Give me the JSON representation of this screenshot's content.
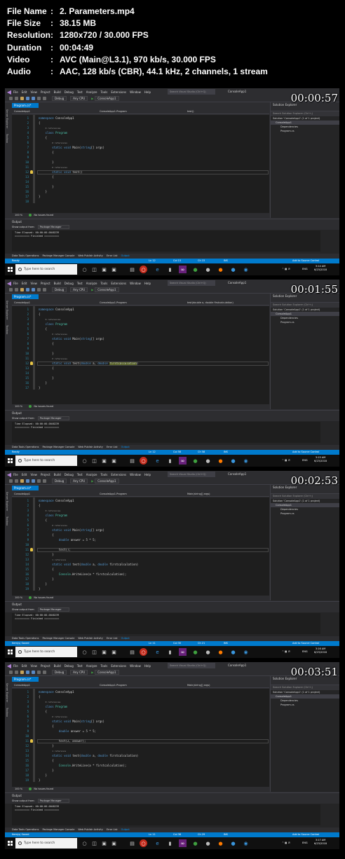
{
  "info": [
    {
      "label": "File Name",
      "value": "2. Parameters.mp4"
    },
    {
      "label": "File Size",
      "value": "38.15 MB"
    },
    {
      "label": "Resolution",
      "value": "1280x720 / 30.000 FPS"
    },
    {
      "label": "Duration",
      "value": "00:04:49"
    },
    {
      "label": "Video",
      "value": "AVC (Main@L3.1), 970 kb/s, 30.000 FPS"
    },
    {
      "label": "Audio",
      "value": "AAC, 128 kb/s (CBR), 44.1 kHz, 2 channels, 1 stream"
    }
  ],
  "colon": ":",
  "ide": {
    "menu": [
      "File",
      "Edit",
      "View",
      "Project",
      "Build",
      "Debug",
      "Test",
      "Analyze",
      "Tools",
      "Extensions",
      "Window",
      "Help"
    ],
    "quick_search": "Search Visual Studio (Ctrl+Q)",
    "project_name": "ConsoleApp1",
    "config": "Debug",
    "platform": "Any CPU",
    "run_target": "ConsoleApp1",
    "side_tab_1": "Server Explorer",
    "side_tab_2": "Toolbox",
    "doc_tab": "Program.cs*",
    "nav_project": "ConsoleApp1",
    "nav_class": "ConsoleApp1.Program",
    "no_issues": "No issues found",
    "zoom": "100 %",
    "solution_explorer": {
      "title": "Solution Explorer",
      "search": "Search Solution Explorer (Ctrl+;)",
      "solution": "Solution 'ConsoleApp1' (1 of 1 project)",
      "project": "ConsoleApp1",
      "dependencies": "Dependencies",
      "file": "Program.cs"
    },
    "output": {
      "title": "Output",
      "show_from_label": "Show output from:",
      "show_from_value": "Package Manager",
      "line1": "Time Elapsed: 00:00:00.0048239",
      "line2": "========== Finished =========="
    },
    "bottom_tabs": [
      "Data Tools Operations",
      "Package Manager Console",
      "Web Publish Activity",
      "Error List",
      "Output"
    ],
    "add_source": "Add to Source Control",
    "ins": "INS"
  },
  "taskbar": {
    "search_placeholder": "Type here to search",
    "lang": "ENG"
  },
  "frames": [
    {
      "timestamp": "00:00:57",
      "nav_member": "test()",
      "status_left": "Ready",
      "ln": "Ln 12",
      "col": "Col 15",
      "ch": "Ch 15",
      "time": "3:14 AM",
      "date": "6/23/2018",
      "lines": [
        {
          "n": "1",
          "html": "<span class='kw'>namespace</span> ConsoleApp1"
        },
        {
          "n": "2",
          "html": "{"
        },
        {
          "n": "3",
          "html": "    <span class='ref'>0 references</span>"
        },
        {
          "n": "4",
          "html": "    <span class='kw'>class</span> <span class='ty'>Program</span>"
        },
        {
          "n": "5",
          "html": "    {"
        },
        {
          "n": "6",
          "html": "        <span class='ref'>0 references</span>"
        },
        {
          "n": "7",
          "html": "        <span class='kw'>static</span> <span class='kw'>void</span> Main(<span class='kw'>string</span>[] args)"
        },
        {
          "n": "8",
          "html": "        {"
        },
        {
          "n": "9",
          "html": ""
        },
        {
          "n": "10",
          "html": "        }"
        },
        {
          "n": "11",
          "html": "        <span class='ref'>0 references</span>"
        },
        {
          "n": "12",
          "html": "        <span class='kw'>static</span> <span class='kw'>void</span> test()"
        },
        {
          "n": "13",
          "html": "        {"
        },
        {
          "n": "14",
          "html": ""
        },
        {
          "n": "15",
          "html": "        }"
        },
        {
          "n": "16",
          "html": "    }"
        },
        {
          "n": "17",
          "html": "}"
        },
        {
          "n": "18",
          "html": ""
        }
      ],
      "cursor_line": 12
    },
    {
      "timestamp": "00:01:55",
      "nav_member": "test(double a, double firstcalculation)",
      "status_left": "Ready",
      "ln": "Ln 12",
      "col": "Col 58",
      "ch": "Ch 58",
      "time": "3:15 AM",
      "date": "6/23/2018",
      "lines": [
        {
          "n": "1",
          "html": "<span class='kw'>namespace</span> ConsoleApp1"
        },
        {
          "n": "2",
          "html": "{"
        },
        {
          "n": "3",
          "html": "    <span class='ref'>0 references</span>"
        },
        {
          "n": "4",
          "html": "    <span class='kw'>class</span> <span class='ty'>Program</span>"
        },
        {
          "n": "5",
          "html": "    {"
        },
        {
          "n": "6",
          "html": "        <span class='ref'>0 references</span>"
        },
        {
          "n": "7",
          "html": "        <span class='kw'>static</span> <span class='kw'>void</span> Main(<span class='kw'>string</span>[] args)"
        },
        {
          "n": "8",
          "html": "        {"
        },
        {
          "n": "9",
          "html": ""
        },
        {
          "n": "10",
          "html": "        }"
        },
        {
          "n": "11",
          "html": "        <span class='ref'>0 references</span>"
        },
        {
          "n": "12",
          "html": "        <span class='kw'>static</span> <span class='kw'>void</span> test(<span class='kw'>double</span> a, <span class='kw'>double</span> <span class='hl'>firstcalculation</span>)"
        },
        {
          "n": "13",
          "html": "        {"
        },
        {
          "n": "14",
          "html": ""
        },
        {
          "n": "15",
          "html": "        }"
        },
        {
          "n": "16",
          "html": "    }"
        },
        {
          "n": "17",
          "html": "}"
        }
      ],
      "cursor_line": 12
    },
    {
      "timestamp": "00:02:53",
      "nav_member": "Main(string[] args)",
      "status_left": "Item(s) Saved",
      "ln": "Ln 11",
      "col": "Col 30",
      "ch": "Ch 21",
      "time": "3:16 AM",
      "date": "6/23/2018",
      "lines": [
        {
          "n": "1",
          "html": "<span class='kw'>namespace</span> ConsoleApp1"
        },
        {
          "n": "2",
          "html": "{"
        },
        {
          "n": "3",
          "html": "    <span class='ref'>0 references</span>"
        },
        {
          "n": "4",
          "html": "    <span class='kw'>class</span> <span class='ty'>Program</span>"
        },
        {
          "n": "5",
          "html": "    {"
        },
        {
          "n": "6",
          "html": "        <span class='ref'>0 references</span>"
        },
        {
          "n": "7",
          "html": "        <span class='kw'>static</span> <span class='kw'>void</span> Main(<span class='kw'>string</span>[] args)"
        },
        {
          "n": "8",
          "html": "        {"
        },
        {
          "n": "9",
          "html": "            <span class='kw'>double</span> answer = 5 * 5;"
        },
        {
          "n": "10",
          "html": ""
        },
        {
          "n": "11",
          "html": "            test();"
        },
        {
          "n": "12",
          "html": "        }"
        },
        {
          "n": "13",
          "html": "        <span class='ref'>1 reference</span>"
        },
        {
          "n": "14",
          "html": "        <span class='kw'>static</span> <span class='kw'>void</span> test(<span class='kw'>double</span> a, <span class='kw'>double</span> firstcalculation)"
        },
        {
          "n": "15",
          "html": "        {"
        },
        {
          "n": "16",
          "html": "            <span class='ty'>Console</span>.WriteLine(a * firstcalculation);"
        },
        {
          "n": "17",
          "html": "        }"
        },
        {
          "n": "18",
          "html": "    }"
        },
        {
          "n": "19",
          "html": "}"
        }
      ],
      "cursor_line": 11
    },
    {
      "timestamp": "00:03:51",
      "nav_member": "Main(string[] args)",
      "status_left": "Item(s) Saved",
      "ln": "Ln 11",
      "col": "Col 38",
      "ch": "Ch 29",
      "time": "3:17 AM",
      "date": "6/23/2018",
      "lines": [
        {
          "n": "1",
          "html": "<span class='kw'>namespace</span> ConsoleApp1"
        },
        {
          "n": "2",
          "html": "{"
        },
        {
          "n": "3",
          "html": "    <span class='ref'>0 references</span>"
        },
        {
          "n": "4",
          "html": "    <span class='kw'>class</span> <span class='ty'>Program</span>"
        },
        {
          "n": "5",
          "html": "    {"
        },
        {
          "n": "6",
          "html": "        <span class='ref'>0 references</span>"
        },
        {
          "n": "7",
          "html": "        <span class='kw'>static</span> <span class='kw'>void</span> Main(<span class='kw'>string</span>[] args)"
        },
        {
          "n": "8",
          "html": "        {"
        },
        {
          "n": "9",
          "html": "            <span class='kw'>double</span> answer = 5 * 5;"
        },
        {
          "n": "10",
          "html": ""
        },
        {
          "n": "11",
          "html": "            test(2, answer);"
        },
        {
          "n": "12",
          "html": "        }"
        },
        {
          "n": "13",
          "html": "        <span class='ref'>1 reference</span>"
        },
        {
          "n": "14",
          "html": "        <span class='kw'>static</span> <span class='kw'>void</span> test(<span class='kw'>double</span> a, <span class='kw'>double</span> firstcalculation)"
        },
        {
          "n": "15",
          "html": "        {"
        },
        {
          "n": "16",
          "html": "            <span class='ty'>Console</span>.WriteLine(a * firstcalculation);"
        },
        {
          "n": "17",
          "html": "        }"
        },
        {
          "n": "18",
          "html": "    }"
        },
        {
          "n": "19",
          "html": "}"
        }
      ],
      "cursor_line": 11
    }
  ],
  "colors": {
    "status_ready": "#007acc",
    "status_saved": "#007acc",
    "accent": "#007acc"
  },
  "icons": {
    "vs_logo": "vs-logo-icon",
    "windows": "windows-logo-icon"
  }
}
